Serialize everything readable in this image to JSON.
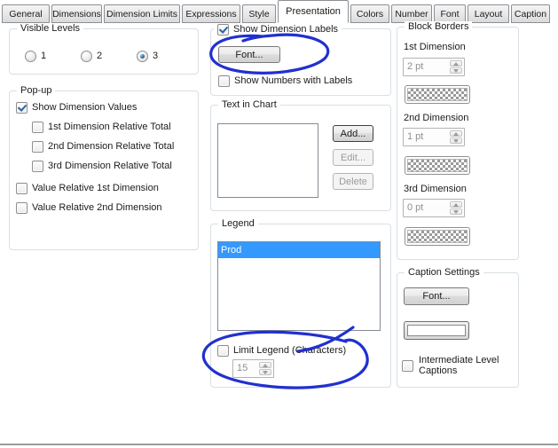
{
  "tabs": [
    {
      "label": "General"
    },
    {
      "label": "Dimensions"
    },
    {
      "label": "Dimension Limits"
    },
    {
      "label": "Expressions"
    },
    {
      "label": "Style"
    },
    {
      "label": "Presentation",
      "active": true
    },
    {
      "label": "Colors"
    },
    {
      "label": "Number"
    },
    {
      "label": "Font"
    },
    {
      "label": "Layout"
    },
    {
      "label": "Caption"
    }
  ],
  "visible_levels": {
    "title": "Visible Levels",
    "options": [
      {
        "label": "1",
        "selected": false
      },
      {
        "label": "2",
        "selected": false
      },
      {
        "label": "3",
        "selected": true
      }
    ]
  },
  "popup": {
    "title": "Pop-up",
    "items": [
      {
        "label": "Show Dimension Values",
        "checked": true,
        "indent": false
      },
      {
        "label": "1st Dimension Relative Total",
        "checked": false,
        "indent": true
      },
      {
        "label": "2nd Dimension Relative Total",
        "checked": false,
        "indent": true
      },
      {
        "label": "3rd Dimension Relative Total",
        "checked": false,
        "indent": true
      },
      {
        "label": "Value Relative 1st Dimension",
        "checked": false,
        "indent": false
      },
      {
        "label": "Value Relative 2nd Dimension",
        "checked": false,
        "indent": false
      }
    ]
  },
  "dimension_labels": {
    "checkbox_label": "Show Dimension Labels",
    "checked": true,
    "font_button": "Font...",
    "numbers_checkbox": "Show Numbers with Labels",
    "numbers_checked": false
  },
  "text_in_chart": {
    "title": "Text in Chart",
    "items": [],
    "add_button": "Add...",
    "edit_button": "Edit...",
    "delete_button": "Delete"
  },
  "legend": {
    "title": "Legend",
    "items": [
      {
        "label": "Prod",
        "selected": true
      }
    ],
    "limit_checkbox": "Limit Legend (Characters)",
    "limit_checked": false,
    "limit_value": "15"
  },
  "block_borders": {
    "title": "Block Borders",
    "entries": [
      {
        "label": "1st Dimension",
        "value": "2 pt"
      },
      {
        "label": "2nd Dimension",
        "value": "1 pt"
      },
      {
        "label": "3rd Dimension",
        "value": "0 pt"
      }
    ]
  },
  "caption_settings": {
    "title": "Caption Settings",
    "font_button": "Font...",
    "intermediate_checkbox": "Intermediate Level Captions",
    "intermediate_checked": false
  },
  "colors": {
    "selection": "#3399ff",
    "ink": "#2130d0"
  }
}
